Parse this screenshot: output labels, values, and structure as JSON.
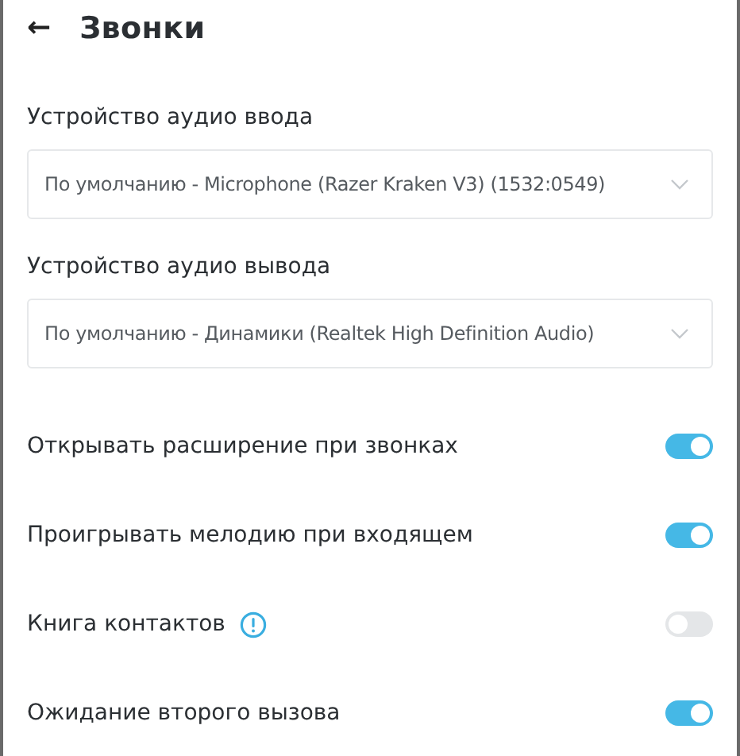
{
  "header": {
    "back": "←",
    "title": "Звонки"
  },
  "devices": [
    {
      "label": "Устройство аудио ввода",
      "value": "По умолчанию - Microphone (Razer Kraken V3) (1532:0549)"
    },
    {
      "label": "Устройство аудио вывода",
      "value": "По умолчанию - Динамики (Realtek High Definition Audio)"
    }
  ],
  "toggles": [
    {
      "label": "Открывать расширение при звонках",
      "on": true,
      "info": false
    },
    {
      "label": "Проигрывать мелодию при входящем",
      "on": true,
      "info": false
    },
    {
      "label": "Книга контактов",
      "on": false,
      "info": true
    },
    {
      "label": "Ожидание второго вызова",
      "on": true,
      "info": false
    }
  ]
}
